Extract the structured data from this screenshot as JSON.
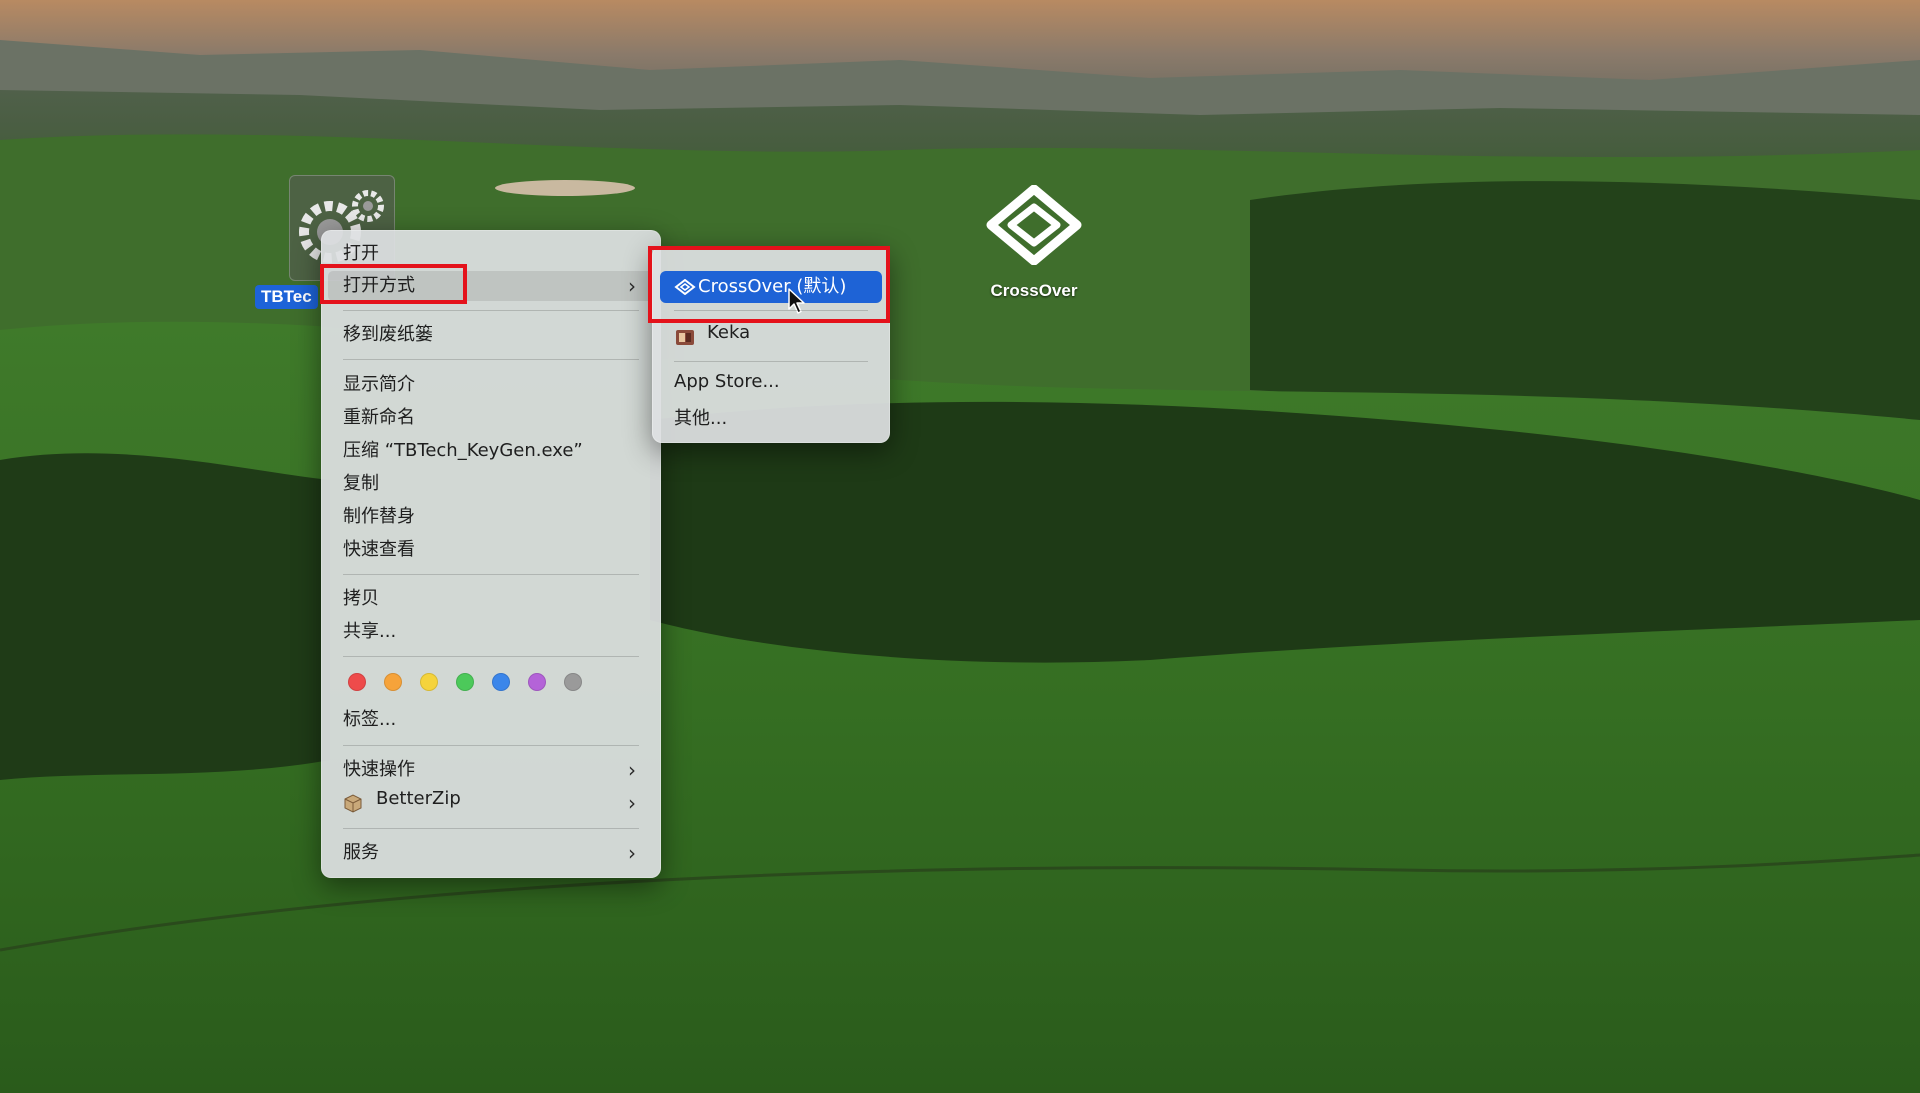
{
  "desktop": {
    "file_icon_label": "TBTec",
    "crossover_label": "CrossOver"
  },
  "context_menu": {
    "open": "打开",
    "open_with": "打开方式",
    "move_to_trash": "移到废纸篓",
    "get_info": "显示简介",
    "rename": "重新命名",
    "compress": "压缩 “TBTech_KeyGen.exe”",
    "duplicate": "复制",
    "make_alias": "制作替身",
    "quick_look": "快速查看",
    "copy": "拷贝",
    "share": "共享...",
    "tags": "标签...",
    "tag_colors": [
      "#ee4b4b",
      "#f6a33a",
      "#f5d33c",
      "#4cc95a",
      "#3b86ea",
      "#b463d8",
      "#9a9a9a"
    ],
    "quick_actions": "快速操作",
    "betterzip": "BetterZip",
    "services": "服务"
  },
  "submenu": {
    "crossover_default": "CrossOver (默认)",
    "keka": "Keka",
    "app_store": "App Store...",
    "other": "其他..."
  },
  "colors": {
    "highlight_blue": "#1e63d6",
    "annotation_red": "#e4121b"
  }
}
